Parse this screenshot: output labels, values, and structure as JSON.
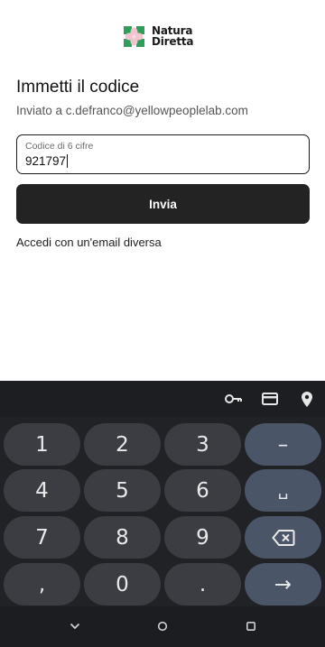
{
  "brand": {
    "line1": "Natura",
    "line2": "Diretta"
  },
  "heading": "Immetti il codice",
  "subtitle": "Inviato a c.defranco@yellowpeoplelab.com",
  "code_field": {
    "label": "Codice di 6 cifre",
    "value": "921797"
  },
  "submit_label": "Invia",
  "alt_link": "Accedi con un'email diversa",
  "keyboard": {
    "suggest_icons": [
      "key-icon",
      "card-icon",
      "location-pin-icon"
    ],
    "rows": [
      [
        "1",
        "2",
        "3",
        "–"
      ],
      [
        "4",
        "5",
        "6",
        "␣"
      ],
      [
        "7",
        "8",
        "9",
        "backspace"
      ],
      [
        ",",
        "0",
        ".",
        "→"
      ]
    ]
  },
  "nav_icons": [
    "back-chevron-icon",
    "home-circle-icon",
    "recents-square-icon"
  ],
  "colors": {
    "primary": "#232323",
    "keyboard_bg": "#202226",
    "key_bg": "#3b3d42",
    "fn_key_bg": "#4b5568",
    "logo_green": "#2f9e5a",
    "logo_pink": "#f3c4cf"
  }
}
